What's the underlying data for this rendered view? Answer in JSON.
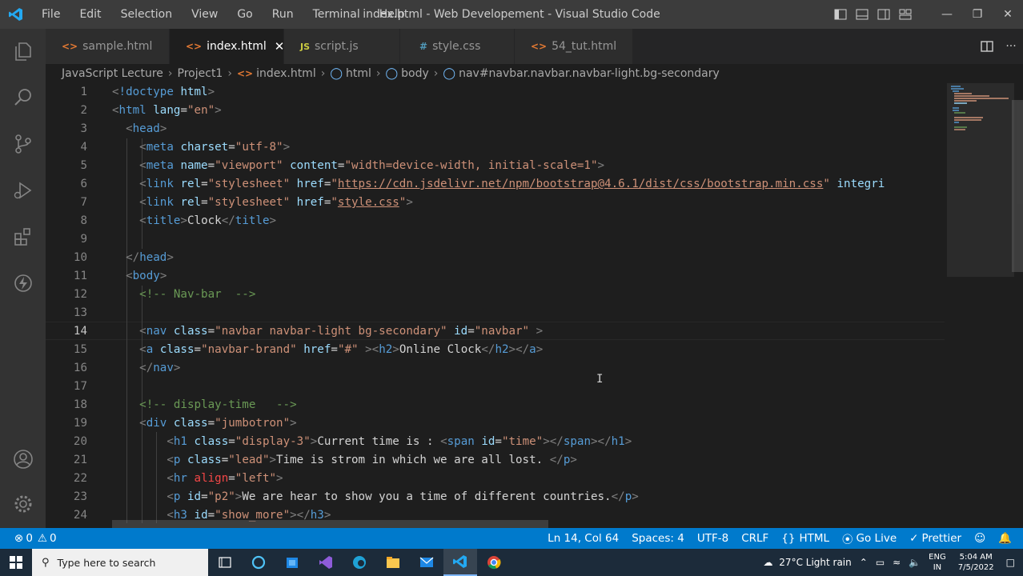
{
  "window": {
    "title": "index.html - Web Developement - Visual Studio Code",
    "menu": [
      "File",
      "Edit",
      "Selection",
      "View",
      "Go",
      "Run",
      "Terminal",
      "Help"
    ]
  },
  "tabs": [
    {
      "label": "sample.html",
      "icon": "html-icon",
      "active": false
    },
    {
      "label": "index.html",
      "icon": "html-icon",
      "active": true
    },
    {
      "label": "script.js",
      "icon": "js-icon",
      "active": false
    },
    {
      "label": "style.css",
      "icon": "css-icon",
      "active": false
    },
    {
      "label": "54_tut.html",
      "icon": "html-icon",
      "active": false
    }
  ],
  "breadcrumb": [
    "JavaScript Lecture",
    "Project1",
    "index.html",
    "html",
    "body",
    "nav#navbar.navbar.navbar-light.bg-secondary"
  ],
  "editor": {
    "line_numbers": [
      "1",
      "2",
      "3",
      "4",
      "5",
      "6",
      "7",
      "8",
      "9",
      "10",
      "11",
      "12",
      "13",
      "14",
      "15",
      "16",
      "17",
      "18",
      "19",
      "20",
      "21",
      "22",
      "23",
      "24"
    ],
    "current_line": "14"
  },
  "statusbar": {
    "problems": "0",
    "warnings": "0",
    "position": "Ln 14, Col 64",
    "spaces": "Spaces: 4",
    "encoding": "UTF-8",
    "eol": "CRLF",
    "language": "HTML",
    "golive": "Go Live",
    "prettier": "Prettier"
  },
  "taskbar": {
    "search_placeholder": "Type here to search",
    "weather": "27°C  Light rain",
    "lang_top": "ENG",
    "lang_bottom": "IN",
    "time": "5:04 AM",
    "date": "7/5/2022"
  },
  "colors": {
    "statusbar": "#007acc",
    "titlebar": "#3c3c3c",
    "editor_bg": "#1e1e1e"
  }
}
